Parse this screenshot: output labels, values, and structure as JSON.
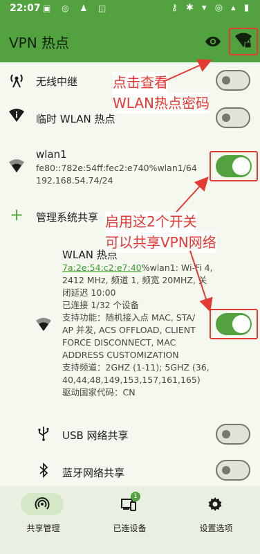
{
  "status_bar": {
    "time": "22:07",
    "left_icons": "▣ ◎ ♟ ◫",
    "right_icons": "⚷ ✱ ▾ ◎ ▴ ▮"
  },
  "app_bar": {
    "title": "VPN 热点",
    "eye_icon": "eye-icon",
    "wifi_lock_icon": "wifi-lock-icon"
  },
  "rows": {
    "repeater": {
      "label": "无线中继",
      "icon": "wifi-tower-icon",
      "enabled": false
    },
    "temp_hotspot": {
      "label": "临时 WLAN 热点",
      "icon": "wifi-info-icon",
      "enabled": false
    },
    "wlan1": {
      "label": "wlan1",
      "line1": "fe80::782e:54ff:fec2:e740%wlan1/64",
      "line2": "192.168.54.74/24",
      "enabled": true
    },
    "manage": {
      "label": "管理系统共享",
      "icon": "plus-icon"
    },
    "wlan_hotspot": {
      "title": "WLAN 热点",
      "mac_link": "7a:2e:54:c2:e7:40",
      "mac_rest": "%wlan1: Wi-Fi 4,",
      "details": [
        "2412 MHz, 频道 1, 频宽 20MHZ, 关",
        "闭延迟 10:00",
        "已连接 1/32 个设备",
        "支持功能：随机接入点 MAC, STA/",
        "AP 并发, ACS OFFLOAD, CLIENT",
        "FORCE DISCONNECT, MAC",
        "ADDRESS CUSTOMIZATION",
        "支持频道：2GHZ (1-11); 5GHZ (36,",
        "40,44,48,149,153,157,161,165)",
        "驱动国家代码：CN"
      ],
      "enabled": true
    },
    "usb": {
      "label": "USB 网络共享",
      "enabled": false
    },
    "bluetooth": {
      "label": "蓝牙网络共享",
      "enabled": false
    }
  },
  "annotations": {
    "top_line1": "点击查看",
    "top_line2": "WLAN热点密码",
    "mid_line1": "启用这2个开关",
    "mid_line2": "可以共享VPN网络"
  },
  "bottom_nav": {
    "items": [
      {
        "label": "共享管理",
        "icon": "hotspot-icon",
        "active": true
      },
      {
        "label": "已连设备",
        "icon": "devices-icon",
        "badge": "1"
      },
      {
        "label": "设置选项",
        "icon": "gear-icon"
      }
    ]
  },
  "colors": {
    "primary": "#52a33f",
    "annotation_red": "#e53935",
    "background": "#f4f8ef"
  }
}
